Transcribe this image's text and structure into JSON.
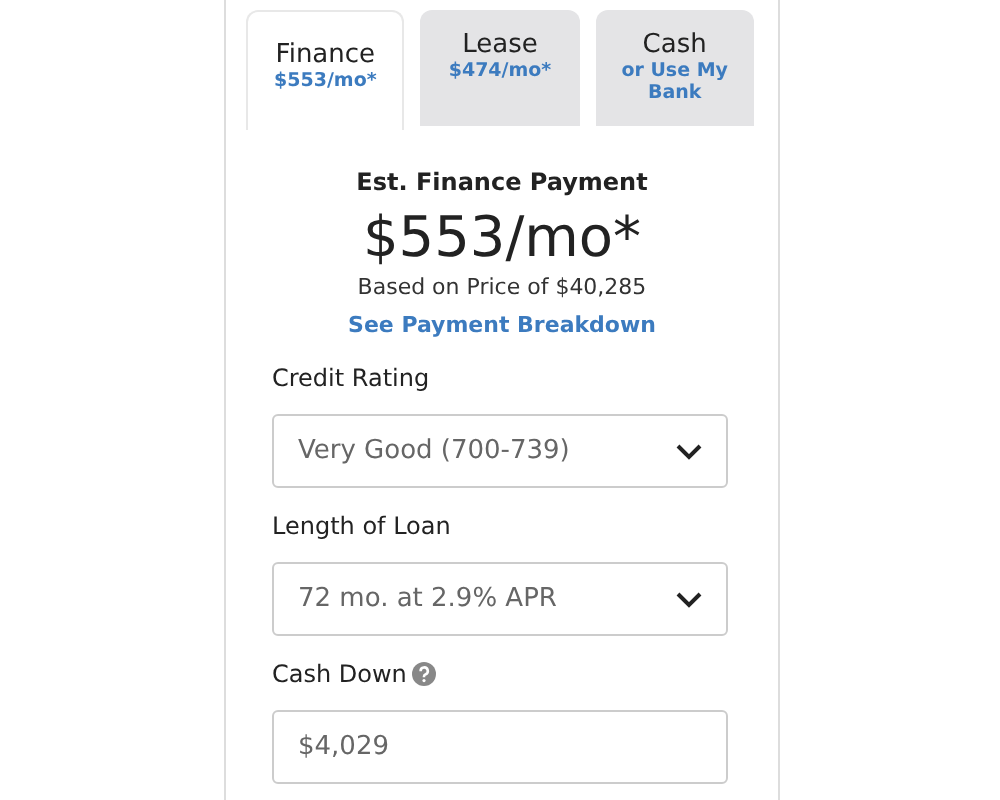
{
  "tabs": [
    {
      "label": "Finance",
      "sub": "$553/mo*",
      "selected": true
    },
    {
      "label": "Lease",
      "sub": "$474/mo*",
      "selected": false
    },
    {
      "label": "Cash",
      "sub": "or Use My Bank",
      "selected": false
    }
  ],
  "summary": {
    "heading": "Est. Finance Payment",
    "amount": "$553/mo*",
    "basis": "Based on Price of $40,285",
    "link": "See Payment Breakdown"
  },
  "fields": [
    {
      "kind": "select",
      "label": "Credit Rating",
      "value": "Very Good (700-739)",
      "help": false
    },
    {
      "kind": "select",
      "label": "Length of Loan",
      "value": "72 mo. at 2.9% APR",
      "help": false
    },
    {
      "kind": "input",
      "label": "Cash Down",
      "value": "$4,029",
      "help": true
    }
  ]
}
